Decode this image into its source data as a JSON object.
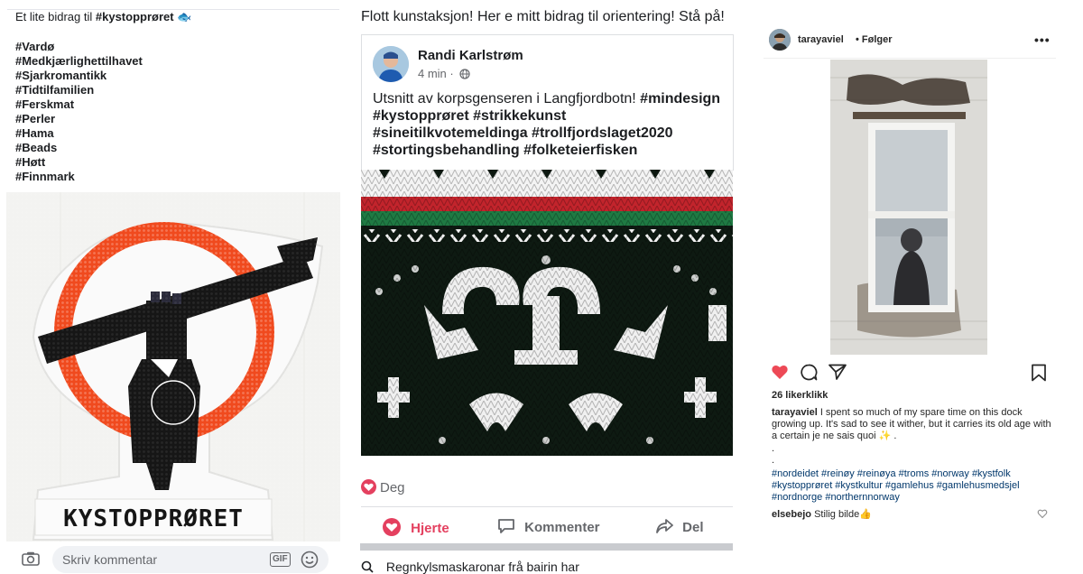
{
  "left": {
    "caption_prefix": "Et lite bidrag til ",
    "caption_tag": "#kystopprøret",
    "caption_emoji": "🐟",
    "hashtags": [
      "#Vardø",
      "#Medkjærlighettilhavet",
      "#Sjarkromantikk",
      "#Tidtilfamilien",
      "#Ferskmat",
      "#Perler",
      "#Hama",
      "#Beads",
      "#Høtt",
      "#Finnmark"
    ],
    "bead_text": "KYSTOPPRØRET",
    "comment_placeholder": "Skriv kommentar",
    "gif_label": "GIF",
    "colors": {
      "bead_orange": "#f04a1e",
      "bead_black": "#161616"
    }
  },
  "middle": {
    "header_text": "Flott kunstaksjon! Her e mitt bidrag til orientering! Stå på!",
    "author": "Randi Karlstrøm",
    "time": "4 min",
    "time_sep": "·",
    "post_text_plain": "Utsnitt av korpsgenseren i Langfjordbotn! ",
    "post_tags": "#mindesign #kystopprøret #strikkekunst #sineitilkvotemeldinga #trollfjordslaget2020 #stortingsbehandling #folketeierfisken",
    "reaction_name": "Deg",
    "actions": {
      "love": "Hjerte",
      "comment": "Kommenter",
      "share": "Del"
    },
    "bottom_text": "Regnkylsmaskaronar frå bairin har",
    "colors": {
      "love": "#e4405f",
      "knit_red": "#c2242c",
      "knit_green": "#1f7a43",
      "knit_dark": "#0e1a12"
    }
  },
  "right": {
    "username": "tarayaviel",
    "follow_label": "Følger",
    "more": "•••",
    "likes": "26 likerklikk",
    "caption_user": "tarayaviel",
    "caption_text": " I spent so much of my spare time on this dock growing up. It's sad to see it wither, but it carries its old age with a certain je ne sais quoi ✨ .",
    "dots": [
      ".",
      "."
    ],
    "hashtags": "#nordeidet #reinøy #reinøya #troms #norway #kystfolk #kystopprøret #kystkultur #gamlehus #gamlehusmedsjel #nordnorge #northernnorway",
    "comment_user": "elsebejo",
    "comment_text": " Stilig bilde👍",
    "colors": {
      "liked": "#ed4956",
      "hashtag": "#00376b"
    }
  }
}
